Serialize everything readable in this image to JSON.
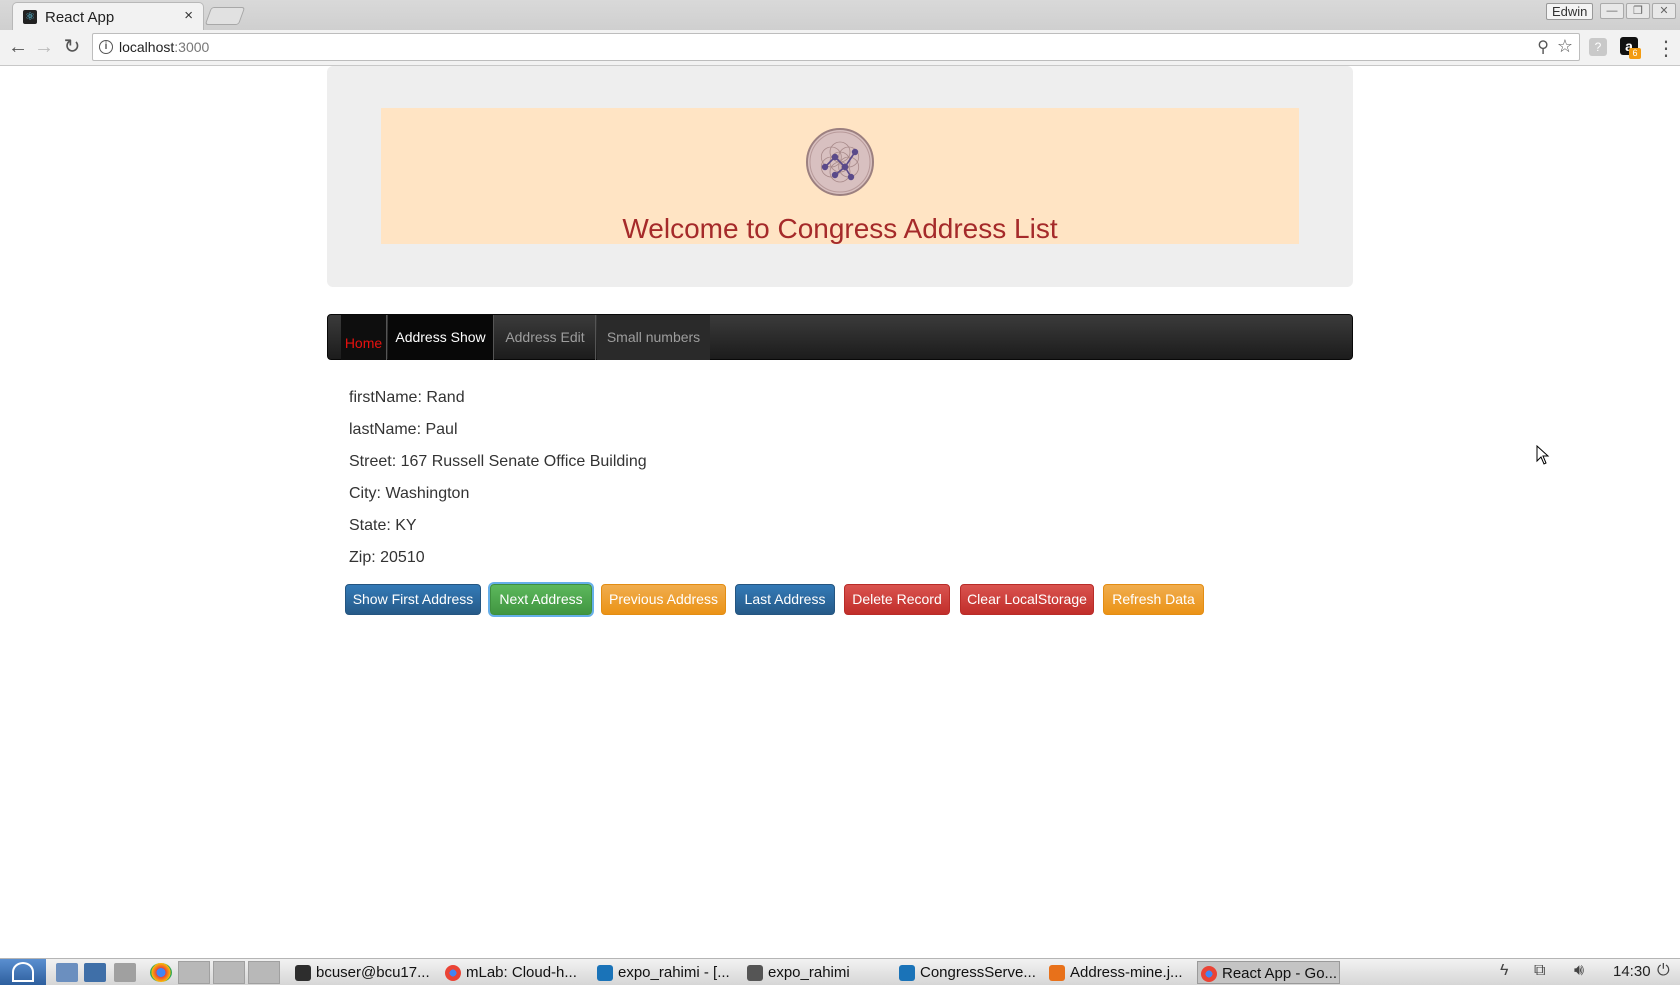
{
  "browser": {
    "tab_title": "React App",
    "tab_close": "×",
    "profile_name": "Edwin",
    "url_host": "localhost",
    "url_port": ":3000",
    "extension_badge": "6"
  },
  "header": {
    "title": "Welcome to Congress Address List"
  },
  "nav": {
    "home": "Home",
    "address_show": "Address Show",
    "address_edit": "Address Edit",
    "small_numbers": "Small numbers"
  },
  "address": {
    "first_name": "firstName: Rand",
    "last_name": "lastName: Paul",
    "street": "Street: 167 Russell Senate Office Building",
    "city": "City: Washington",
    "state": "State: KY",
    "zip": "Zip: 20510"
  },
  "buttons": {
    "show_first": "Show First Address",
    "next": "Next Address",
    "previous": "Previous Address",
    "last": "Last Address",
    "delete": "Delete Record",
    "clear_storage": "Clear LocalStorage",
    "refresh": "Refresh Data"
  },
  "colors": {
    "banner_bg": "#ffe4c4",
    "title_color": "#a52a2a",
    "nav_active_home": "#e8110f",
    "primary": "#337ab7",
    "success": "#5cb85c",
    "warning": "#f0ad4e",
    "danger": "#d9534f"
  },
  "taskbar": {
    "tasks": [
      "bcuser@bcu17...",
      "mLab: Cloud-h...",
      "expo_rahimi - [...",
      "expo_rahimi",
      "CongressServe...",
      "Address-mine.j...",
      "React App - Go..."
    ],
    "clock": "14:30"
  }
}
